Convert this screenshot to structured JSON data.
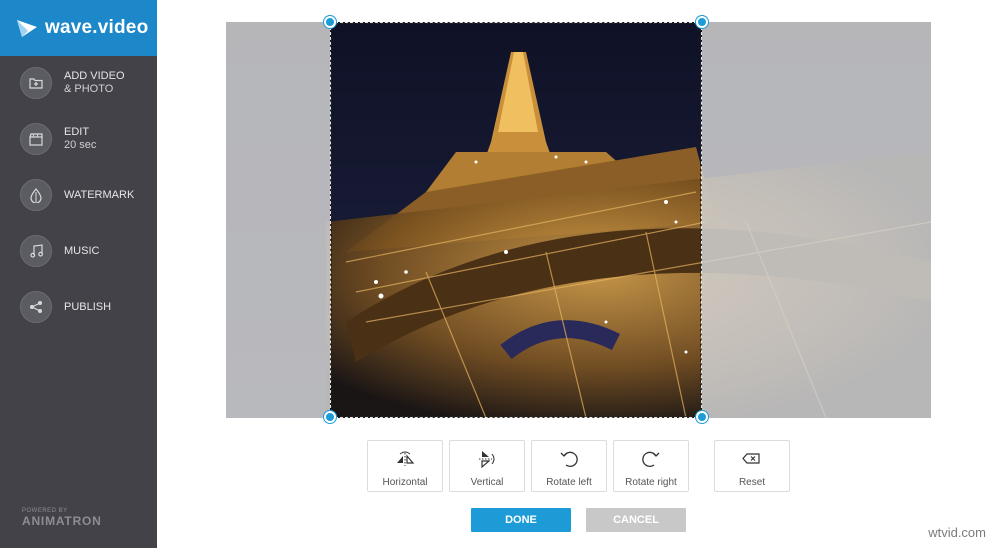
{
  "app": {
    "name": "wave.video"
  },
  "sidebar": {
    "items": [
      {
        "label": "ADD VIDEO",
        "sub": "& PHOTO",
        "icon": "folder-icon"
      },
      {
        "label": "EDIT",
        "sub": "20 sec",
        "icon": "clapperboard-icon"
      },
      {
        "label": "WATERMARK",
        "sub": "",
        "icon": "drop-icon"
      },
      {
        "label": "MUSIC",
        "sub": "",
        "icon": "music-note-icon"
      },
      {
        "label": "PUBLISH",
        "sub": "",
        "icon": "share-icon"
      }
    ],
    "powered_by": "POWERED BY",
    "powered_name": "ANIMATRON"
  },
  "tools": [
    {
      "label": "Horizontal",
      "icon": "flip-horizontal-icon"
    },
    {
      "label": "Vertical",
      "icon": "flip-vertical-icon"
    },
    {
      "label": "Rotate left",
      "icon": "rotate-left-icon"
    },
    {
      "label": "Rotate right",
      "icon": "rotate-right-icon"
    },
    {
      "label": "Reset",
      "icon": "backspace-icon"
    }
  ],
  "actions": {
    "done": "DONE",
    "cancel": "CANCEL"
  },
  "watermark": "wtvid.com",
  "colors": {
    "brand": "#1c87c9",
    "accent": "#1c9bd6",
    "sidebar": "#424248"
  }
}
